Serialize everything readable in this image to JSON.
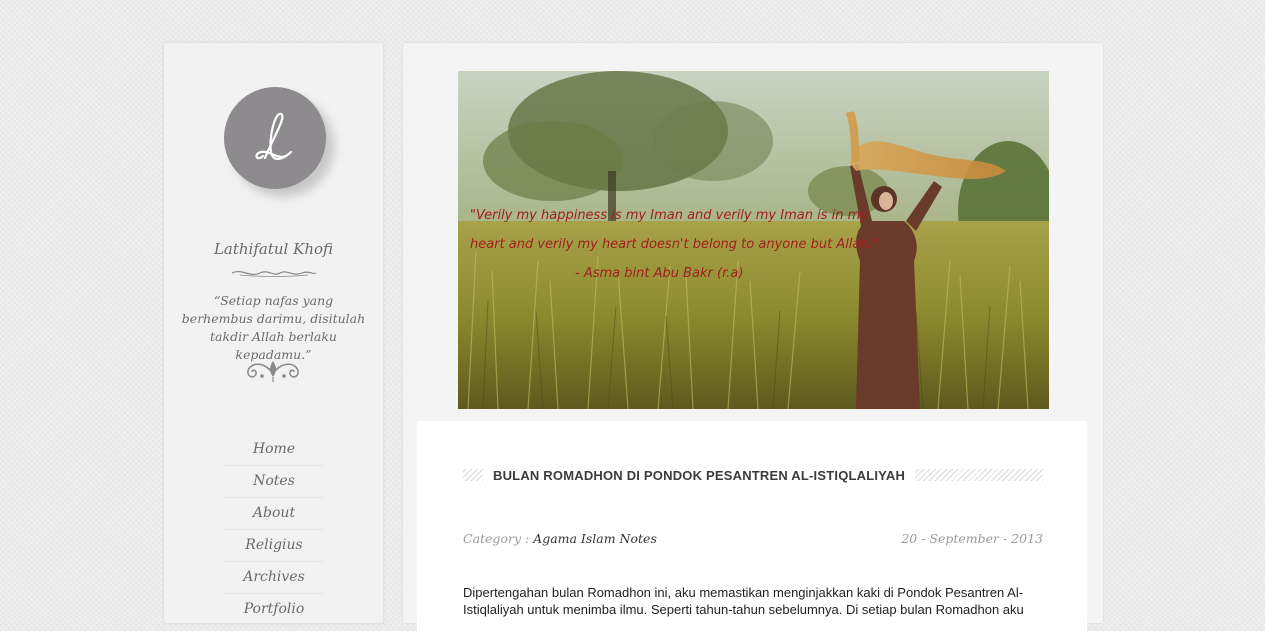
{
  "sidebar": {
    "logo_letter": "L",
    "title": "Lathifatul Khofi",
    "tagline": "“Setiap nafas yang berhembus darimu, disitulah takdir Allah berlaku kepadamu.”",
    "nav": [
      "Home",
      "Notes",
      "About",
      "Religius",
      "Archives",
      "Portfolio"
    ]
  },
  "hero": {
    "quote_lines": [
      "\"Verily my happiness is my Iman and verily my Iman is in my",
      "heart and verily my heart doesn't belong to anyone but Allah.\"",
      "- Asma bint Abu Bakr (r.a)"
    ]
  },
  "post": {
    "title": "BULAN ROMADHON DI PONDOK PESANTREN AL-ISTIQLALIYAH",
    "category_label": "Category :",
    "category": "Agama Islam Notes",
    "date": "20 - September - 2013",
    "body": "Dipertengahan bulan Romadhon ini, aku memastikan menginjakkan kaki di Pondok Pesantren Al-Istiqlaliyah untuk menimba ilmu. Seperti tahun-tahun sebelumnya. Di setiap bulan Romadhon aku"
  },
  "colors": {
    "logo_bg": "#8d8b8e",
    "quote_text": "#a11f1c",
    "page_bg": "#ebebeb"
  }
}
